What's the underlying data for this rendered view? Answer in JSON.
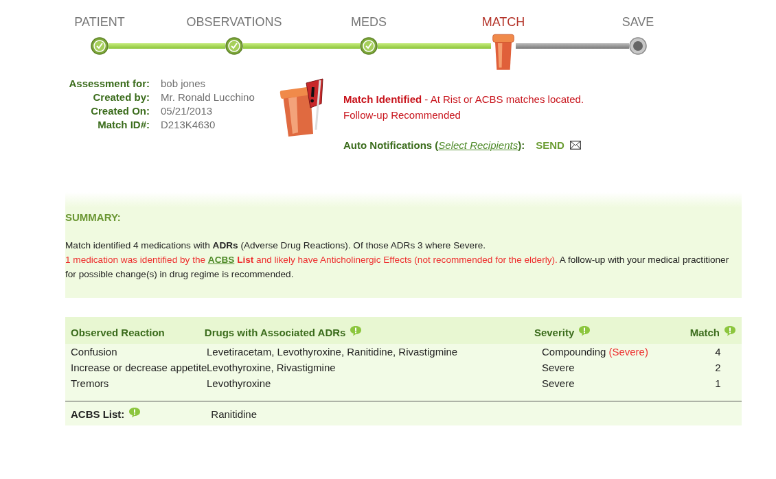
{
  "steps": [
    {
      "label": "PATIENT",
      "completed": true,
      "selected": false
    },
    {
      "label": "OBSERVATIONS",
      "completed": true,
      "selected": false
    },
    {
      "label": "MEDS",
      "completed": true,
      "selected": false
    },
    {
      "label": "MATCH",
      "completed": false,
      "selected": true
    },
    {
      "label": "SAVE",
      "completed": false,
      "selected": false
    }
  ],
  "assessment": [
    {
      "label": "Assessment for:",
      "value": "bob jones"
    },
    {
      "label": "Created by:",
      "value": "Mr. Ronald Lucchino"
    },
    {
      "label": "Created On:",
      "value": "05/21/2013"
    },
    {
      "label": "Match ID#:",
      "value": "D213K4630"
    }
  ],
  "alert": {
    "title": "Match Identified",
    "message": " - At Rist or ACBS matches located.",
    "followup": "Follow-up Recommended"
  },
  "notifications": {
    "label": "Auto Notifications (",
    "link": "Select Recipients",
    "suffix": "):",
    "send": "SEND"
  },
  "summary": {
    "title": "SUMMARY:",
    "segments": [
      {
        "kind": "plain",
        "text": "Match identified 4 medications with **ADRs** (Adverse Drug Reactions). Of those ADRs 3 where Severe. "
      },
      {
        "kind": "alert",
        "text": "1 medication was identified by the "
      },
      {
        "kind": "link",
        "text": "ACBS"
      },
      {
        "kind": "alert",
        "text": " **List** and likely have Anticholinergic Effects (not recommended for the elderly)."
      },
      {
        "kind": "plain",
        "text": " A follow-up with your medical practitioner for possible change(s) in drug regime is recommended."
      }
    ]
  },
  "table": {
    "columns": [
      {
        "label": "Observed Reaction",
        "help": false
      },
      {
        "label": "Drugs with Associated ADRs",
        "help": true
      },
      {
        "label": "Severity",
        "help": true
      },
      {
        "label": "Match",
        "help": true
      }
    ],
    "rows": [
      {
        "reaction": "Confusion",
        "drugs": "Levetiracetam, Levothyroxine, Ranitidine, Rivastigmine",
        "severity": "Compounding",
        "severity_note": "(Severe)",
        "match": "4"
      },
      {
        "reaction": "Increase or decrease appetite",
        "drugs": "Levothyroxine, Rivastigmine",
        "severity": "Severe",
        "match": "2"
      },
      {
        "reaction": "Tremors",
        "drugs": "Levothyroxine",
        "severity": "Severe",
        "match": "1"
      }
    ]
  },
  "acbs": {
    "label": "ACBS List:",
    "value": "Ranitidine"
  }
}
